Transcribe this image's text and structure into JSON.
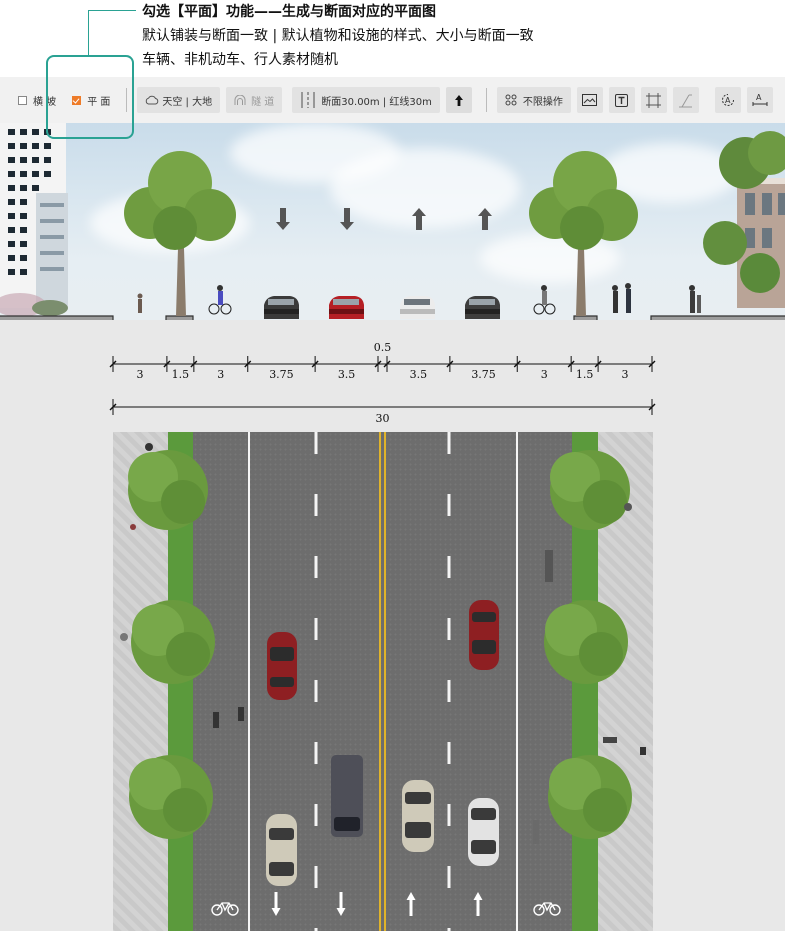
{
  "annotation": {
    "title": "勾选【平面】功能——生成与断面对应的平面图",
    "line2": "默认铺装与断面一致 | 默认植物和设施的样式、大小与断面一致",
    "line3": "车辆、非机动车、行人素材随机"
  },
  "toolbar": {
    "checkbox_section": {
      "label": "横 坡",
      "checked": false
    },
    "checkbox_plan": {
      "label": "平 面",
      "checked": true
    },
    "sky_ground_button": "天空 | 大地",
    "tunnel_button": "隧 道",
    "section_info": "断面30.00m  |  红线30m",
    "unlimited_button": "不限操作",
    "icons": [
      "cloud-icon",
      "tunnel-icon",
      "lanes-icon",
      "arrow-up-icon",
      "grid-icon",
      "image-icon",
      "text-icon",
      "frame-icon",
      "slope-icon",
      "rotate-text-icon",
      "dimension-text-icon"
    ],
    "accent_color": "#ee7b28",
    "highlight_color": "#2aa293"
  },
  "dimensions": {
    "segments": [
      "3",
      "1.5",
      "3",
      "3.75",
      "3.5",
      "0.5",
      "3.5",
      "3.75",
      "3",
      "1.5",
      "3"
    ],
    "total": "30"
  },
  "plan": {
    "lane_markings": [
      "bike-icon",
      "arrow-down-icon",
      "arrow-down-icon",
      "arrow-up-icon",
      "arrow-up-icon",
      "bike-icon"
    ]
  }
}
